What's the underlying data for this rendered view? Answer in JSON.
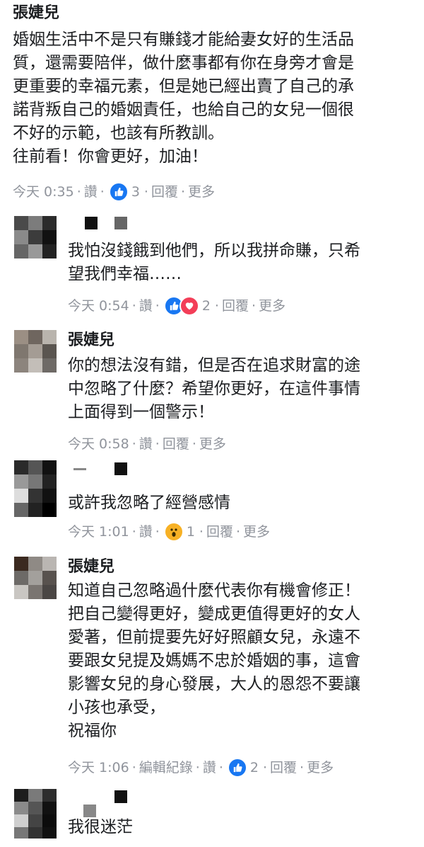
{
  "top_comment": {
    "author": "張婕兒",
    "lines": [
      "婚姻生活中不是只有賺錢才能給妻女好的生活品",
      "質，還需要陪伴，做什麼事都有你在身旁才會是",
      "更重要的幸福元素，但是她已經出賣了自己的承",
      "諾背叛自己的婚姻責任，也給自己的女兒一個很",
      "不好的示範，也該有所教訓。",
      "往前看！你會更好，加油！"
    ],
    "time": "今天 0:35",
    "like_label": "讚",
    "reaction_count": "3",
    "reply_label": "回覆",
    "more_label": "更多"
  },
  "replies": [
    {
      "author": "",
      "lines": [
        "我怕沒錢餓到他們，所以我拼命賺，只希",
        "望我們幸福……"
      ],
      "time": "今天 0:54",
      "like_label": "讚",
      "reaction_count": "2",
      "reply_label": "回覆",
      "more_label": "更多",
      "reactions": [
        "like-icon",
        "love-icon"
      ]
    },
    {
      "author": "張婕兒",
      "lines": [
        "你的想法沒有錯，但是否在追求財富的途",
        "中忽略了什麼？希望你更好，在這件事情",
        "上面得到一個警示！"
      ],
      "time": "今天 0:58",
      "like_label": "讚",
      "reply_label": "回覆",
      "more_label": "更多"
    },
    {
      "author": "",
      "lines": [
        "或許我忽略了經營感情"
      ],
      "time": "今天 1:01",
      "like_label": "讚",
      "reaction_count": "1",
      "reply_label": "回覆",
      "more_label": "更多",
      "reactions": [
        "wow-icon"
      ]
    },
    {
      "author": "張婕兒",
      "lines": [
        "知道自己忽略過什麼代表你有機會修正！",
        "把自己變得更好，變成更值得更好的女人",
        "愛著，但前提要先好好照顧女兒，永遠不",
        "要跟女兒提及媽媽不忠於婚姻的事，這會",
        "影響女兒的身心發展，大人的恩怨不要讓",
        "小孩也承受，",
        "祝福你"
      ],
      "time": "今天 1:06",
      "edit_history_label": "編輯紀錄",
      "like_label": "讚",
      "reaction_count": "2",
      "reply_label": "回覆",
      "more_label": "更多",
      "reactions": [
        "like-icon"
      ]
    },
    {
      "author": "",
      "lines": [
        "我很迷茫"
      ]
    }
  ],
  "colors": {
    "like": "#1877f2",
    "love": "#f33e58",
    "wow": "#f7b125",
    "meta": "#90949c"
  }
}
